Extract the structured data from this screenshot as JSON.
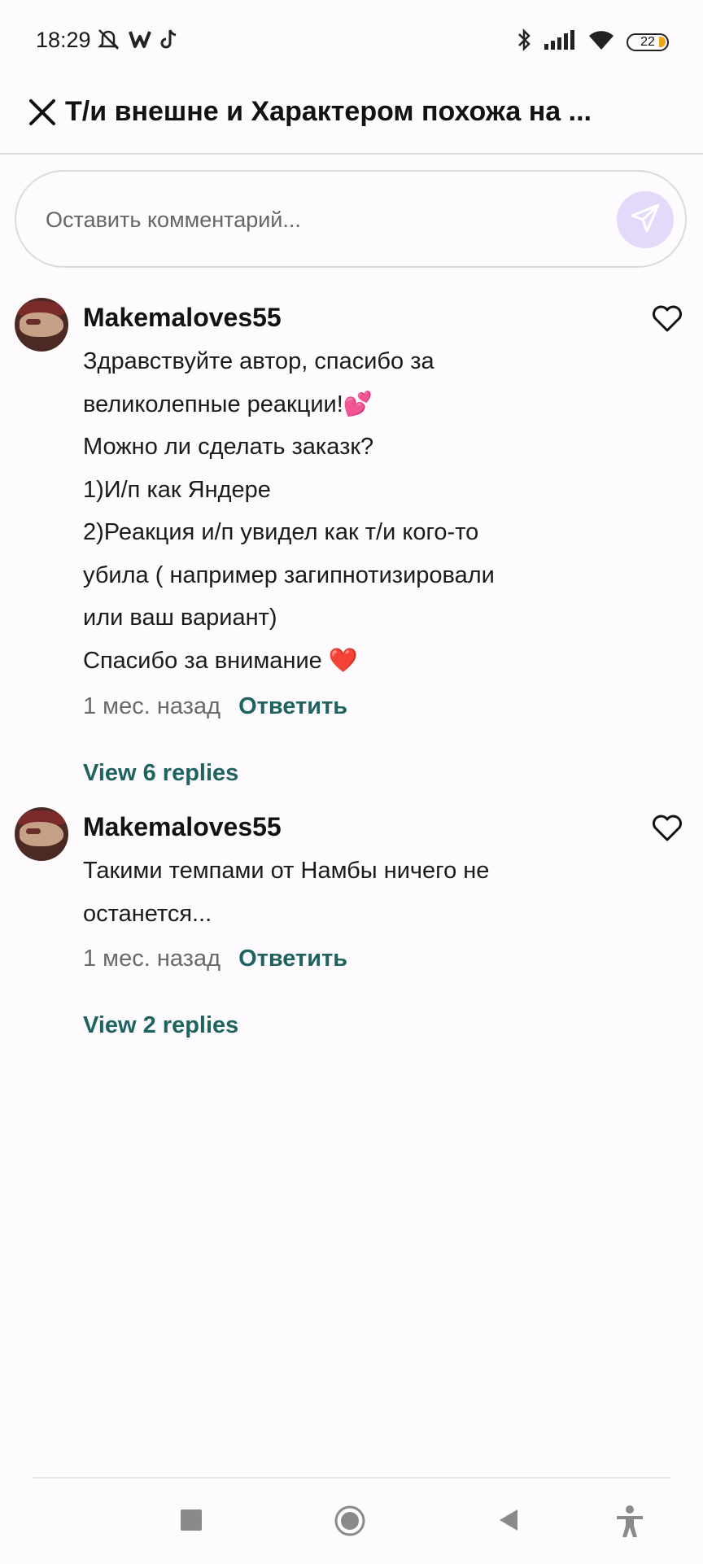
{
  "status_bar": {
    "time": "18:29",
    "battery": "22",
    "icons": [
      "mute-icon",
      "wattpad-icon",
      "tiktok-icon",
      "bluetooth-icon",
      "signal-icon",
      "wifi-icon",
      "battery-icon"
    ]
  },
  "header": {
    "title": "Т/и внешне и Характером похожа на ..."
  },
  "comment_input": {
    "placeholder": "Оставить комментарий..."
  },
  "comments": [
    {
      "username": "Makemaloves55",
      "lines": [
        "Здравствуйте автор, спасибо за",
        "великолепные реакции!💕",
        "Можно ли сделать заказк?",
        "1)И/п как Яндере",
        "2)Реакция и/п увидел как т/и кого-то",
        "убила ( например загипнотизировали",
        "или ваш вариант)",
        "Спасибо за внимание ❤️"
      ],
      "time": "1 мес. назад",
      "reply_label": "Ответить",
      "view_replies": "View 6 replies"
    },
    {
      "username": "Makemaloves55",
      "lines": [
        "Такими темпами от Намбы ничего не",
        "останется..."
      ],
      "time": "1 мес. назад",
      "reply_label": "Ответить",
      "view_replies": "View 2 replies"
    }
  ],
  "colors": {
    "accent": "#1f6360",
    "send_button_bg": "#e3d9fb",
    "send_icon": "#ffffff"
  }
}
